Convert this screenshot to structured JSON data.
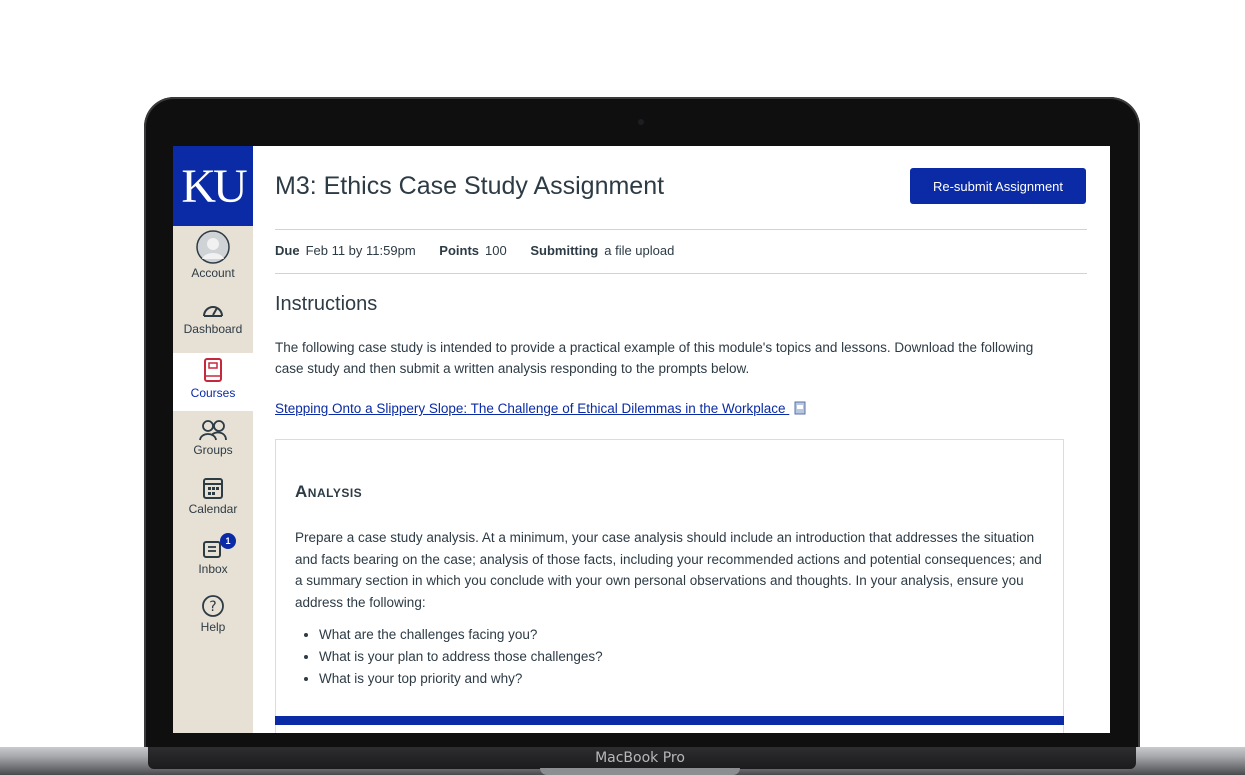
{
  "device": {
    "model": "MacBook Pro"
  },
  "sidebar": {
    "logo": "KU",
    "items": [
      {
        "label": "Account",
        "icon": "account-icon"
      },
      {
        "label": "Dashboard",
        "icon": "dashboard-icon"
      },
      {
        "label": "Courses",
        "icon": "courses-icon",
        "active": true
      },
      {
        "label": "Groups",
        "icon": "groups-icon"
      },
      {
        "label": "Calendar",
        "icon": "calendar-icon"
      },
      {
        "label": "Inbox",
        "icon": "inbox-icon",
        "badge": "1"
      },
      {
        "label": "Help",
        "icon": "help-icon"
      }
    ]
  },
  "assignment": {
    "title": "M3: Ethics Case Study Assignment",
    "resubmit_label": "Re-submit Assignment",
    "due_label": "Due",
    "due_value": "Feb 11 by 11:59pm",
    "points_label": "Points",
    "points_value": "100",
    "submitting_label": "Submitting",
    "submitting_value": "a file upload"
  },
  "instructions": {
    "heading": "Instructions",
    "text": "The following case study is intended to provide a practical example of this module's topics and lessons. Download the following case study and then submit a written analysis responding to the prompts below.",
    "link": "Stepping Onto a Slippery Slope: The Challenge of Ethical Dilemmas in the Workplace"
  },
  "analysis": {
    "heading": "Analysis",
    "text": "Prepare a case study analysis. At a minimum, your case analysis should include an introduction that addresses the situation and facts bearing on the case; analysis of those facts, including your recommended actions and potential consequences; and a summary section in which you conclude with your own personal observations and thoughts. In your analysis, ensure you address the following:",
    "bullets": [
      "What are the challenges facing you?",
      "What is your plan to address those challenges?",
      "What is your top priority and why?"
    ]
  },
  "colors": {
    "brand": "#0a2ba5",
    "sidebar_bg": "#e7e1d5",
    "text": "#2d3b45"
  }
}
